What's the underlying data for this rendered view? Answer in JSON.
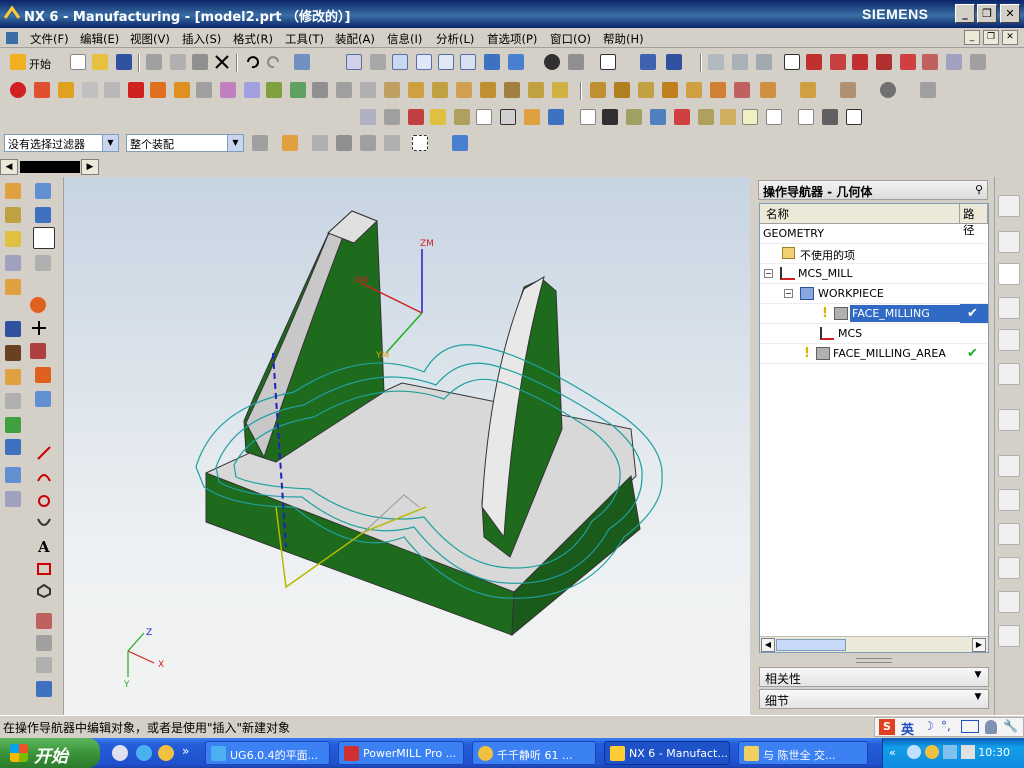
{
  "window": {
    "title": "NX 6 - Manufacturing - [model2.prt （修改的）]",
    "brand": "SIEMENS",
    "minimize": "_",
    "restore": "❐",
    "close": "✕"
  },
  "menu": {
    "items": [
      "文件(F)",
      "编辑(E)",
      "视图(V)",
      "插入(S)",
      "格式(R)",
      "工具(T)",
      "装配(A)",
      "信息(I)",
      "分析(L)",
      "首选项(P)",
      "窗口(O)",
      "帮助(H)"
    ]
  },
  "toolbar": {
    "start_label": "开始",
    "selection_filter": "没有选择过滤器",
    "assembly_scope": "整个装配"
  },
  "viewport": {
    "axis_labels": {
      "zm": "ZM",
      "xm": "XM",
      "ym": "YM",
      "x": "X",
      "y": "Y",
      "z": "Z"
    }
  },
  "navigator": {
    "title": "操作导航器 - 几何体",
    "columns": [
      "名称",
      "路径"
    ],
    "rows": [
      {
        "label": "GEOMETRY",
        "level": 0,
        "icon": "none",
        "selected": false,
        "status": ""
      },
      {
        "label": "不使用的项",
        "level": 1,
        "icon": "folder-icon",
        "selected": false,
        "status": ""
      },
      {
        "label": "MCS_MILL",
        "level": 1,
        "icon": "mcs-icon",
        "selected": false,
        "status": ""
      },
      {
        "label": "WORKPIECE",
        "level": 2,
        "icon": "workpiece-icon",
        "selected": false,
        "status": ""
      },
      {
        "label": "FACE_MILLING",
        "level": 3,
        "icon": "face-milling-icon",
        "selected": true,
        "status": "✔"
      },
      {
        "label": "MCS",
        "level": 3,
        "icon": "mcs-icon",
        "selected": false,
        "status": ""
      },
      {
        "label": "FACE_MILLING_AREA",
        "level": 2,
        "icon": "face-milling-icon",
        "selected": false,
        "status": "✔"
      }
    ],
    "panels": [
      "相关性",
      "细节"
    ]
  },
  "status_bar": {
    "message": "在操作导航器中编辑对象，或者是使用\"插入\"新建对象"
  },
  "taskbar": {
    "start_label": "开始",
    "tasks": [
      {
        "label": "UG6.0.4的平面...",
        "active": false
      },
      {
        "label": "PowerMILL Pro ...",
        "active": false
      },
      {
        "label": "千千静听  61 ...",
        "active": false
      },
      {
        "label": "NX 6 - Manufact...",
        "active": true
      },
      {
        "label": "与 陈世全 交...",
        "active": false
      }
    ],
    "ime_label": "英",
    "clock": "10:30"
  },
  "colors": {
    "titlebar": "#0a246a",
    "selection": "#316ac5",
    "part_green": "#1e6b1e",
    "part_gray": "#d8d8d8",
    "toolpath": "#20a0a0",
    "ok_check": "#22aa22"
  }
}
